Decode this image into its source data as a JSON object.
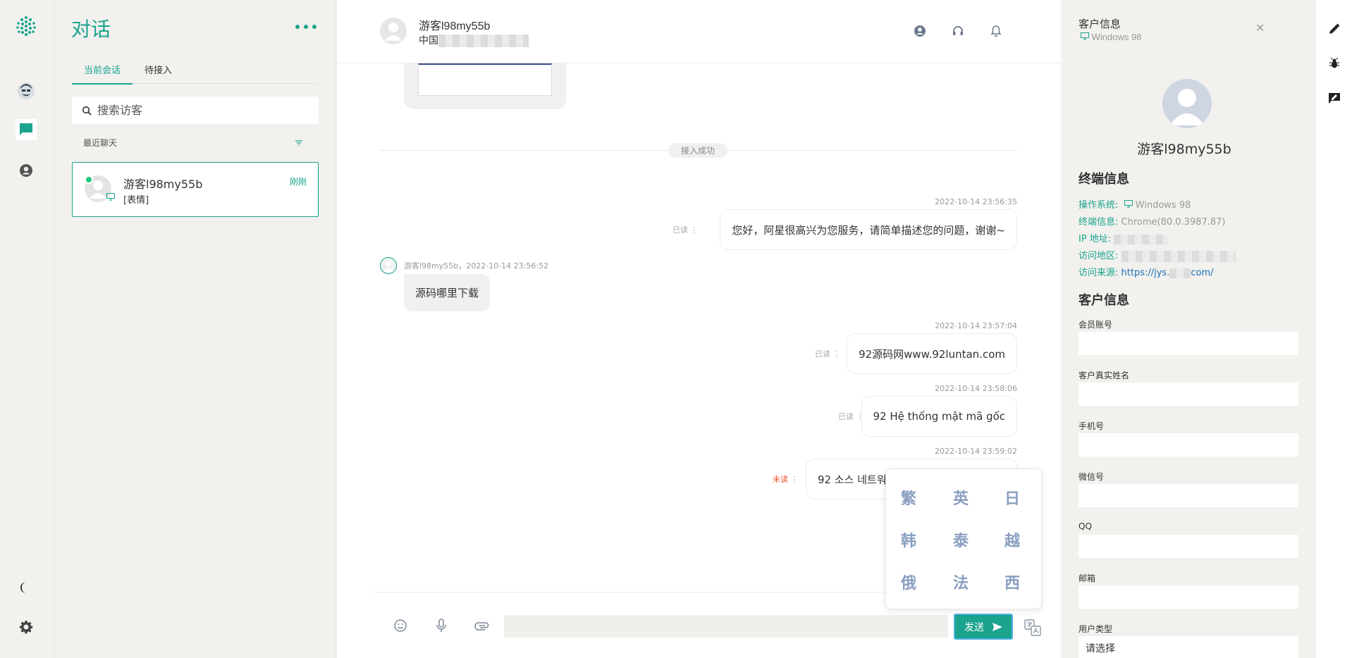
{
  "rail": {
    "icons": [
      "logo-icon",
      "agent-avatar-icon",
      "chat-icon",
      "user-icon",
      "moon-icon",
      "gear-icon"
    ]
  },
  "conversations": {
    "title": "对话",
    "tabs": [
      "当前会话",
      "待接入"
    ],
    "search_placeholder": "搜索访客",
    "recent_label": "最近聊天",
    "items": [
      {
        "name": "游客l98my55b",
        "time": "刚刚",
        "preview": "[表情]",
        "online": true
      }
    ]
  },
  "chat": {
    "visitor_name": "游客l98my55b",
    "visitor_location": "中国",
    "divider_label": "接入成功",
    "messages_out": [
      {
        "time": "2022-10-14 23:56:35",
        "text": "您好，阿星很高兴为您服务，请简单描述您的问题，谢谢~",
        "status": "已读"
      },
      {
        "time": "2022-10-14 23:57:04",
        "text": "92源码网www.92luntan.com",
        "status": "已读"
      },
      {
        "time": "2022-10-14 23:58:06",
        "text": "92 Hệ thống mật mã gốc",
        "status": "已读"
      },
      {
        "time": "2022-10-14 23:59:02",
        "text": "92 소스 네트워",
        "status": "未读"
      }
    ],
    "message_in": {
      "meta": "游客l98my55b，2022-10-14 23:56:52",
      "text": "源码哪里下载"
    },
    "languages": [
      "繁",
      "英",
      "日",
      "韩",
      "泰",
      "越",
      "俄",
      "法",
      "西"
    ],
    "send_label": "发送",
    "input_value": ""
  },
  "customer": {
    "panel_title": "客户信息",
    "os_badge": "Windows 98",
    "name": "游客l98my55b",
    "terminal_title": "终端信息",
    "terminal": {
      "os_label": "操作系统:",
      "os_value": "Windows 98",
      "browser_label": "终端信息:",
      "browser_value": "Chrome(80.0.3987.87)",
      "ip_label": "IP 地址:",
      "region_label": "访问地区:",
      "source_label": "访问来源:",
      "source_prefix": "https://jys.",
      "source_suffix": "com/"
    },
    "customer_title": "客户信息",
    "fields": [
      {
        "label": "会员账号",
        "value": ""
      },
      {
        "label": "客户真实姓名",
        "value": ""
      },
      {
        "label": "手机号",
        "value": ""
      },
      {
        "label": "微信号",
        "value": ""
      },
      {
        "label": "QQ",
        "value": ""
      },
      {
        "label": "邮箱",
        "value": ""
      },
      {
        "label": "用户类型",
        "value": "请选择"
      }
    ]
  },
  "colors": {
    "accent": "#1aa38d",
    "unread": "#e8562a",
    "link": "#1a6fb5"
  }
}
